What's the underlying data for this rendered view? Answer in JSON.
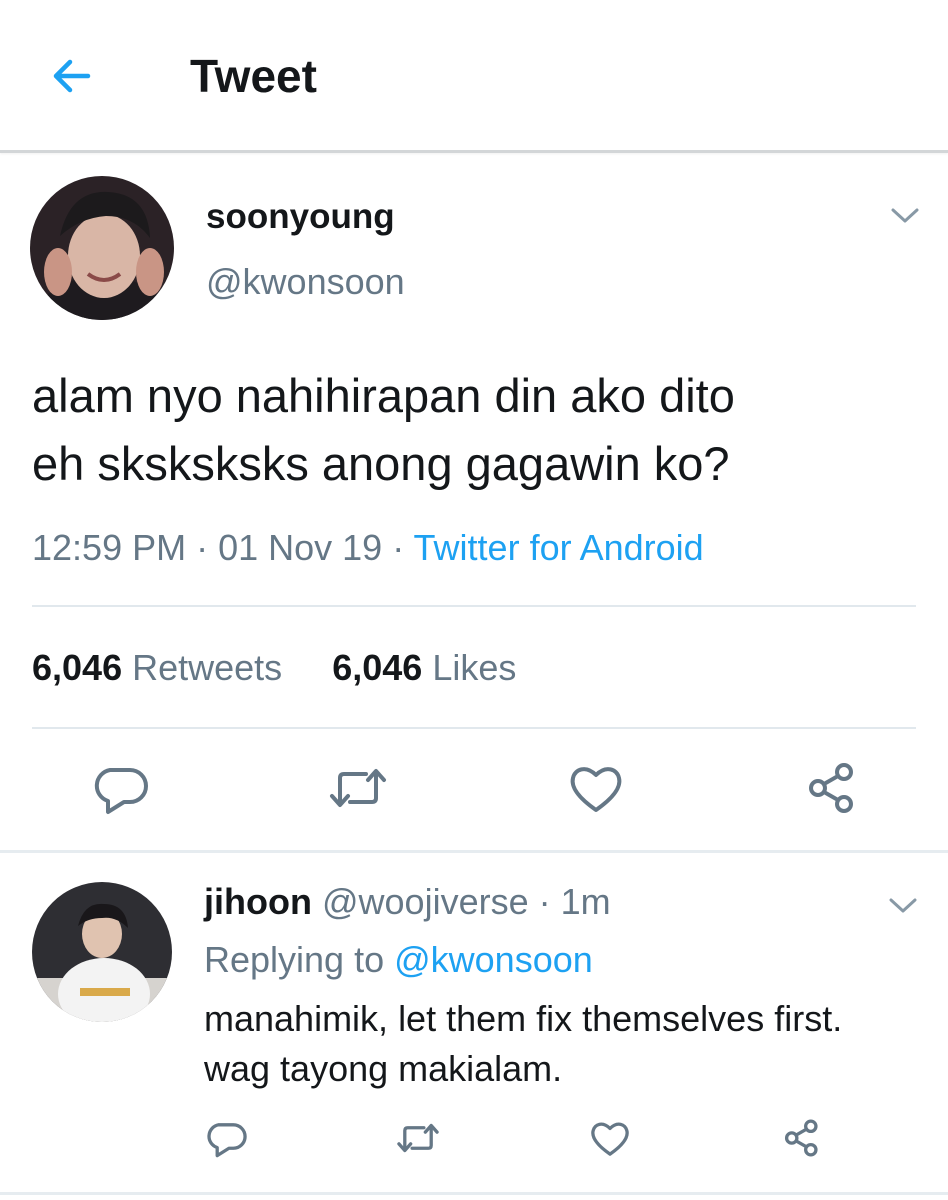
{
  "header": {
    "title": "Tweet",
    "back_icon": "back-arrow-icon"
  },
  "colors": {
    "accent": "#1da1f2",
    "secondary_text": "#657786",
    "primary_text": "#14171a",
    "divider": "#e1e8ed"
  },
  "tweet": {
    "author_name": "soonyoung",
    "author_handle": "@kwonsoon",
    "text_line1": "alam nyo nahihirapan din ako dito",
    "text_line2": "eh sksksksks anong gagawin ko?",
    "time": "12:59 PM",
    "sep1": " · ",
    "date": "01 Nov 19",
    "sep2": " · ",
    "source": "Twitter for Android",
    "retweet_count": "6,046",
    "retweet_label": "Retweets",
    "like_count": "6,046",
    "like_label": "Likes",
    "actions": [
      "reply-icon",
      "retweet-icon",
      "like-icon",
      "share-icon"
    ]
  },
  "reply": {
    "author_name": "jihoon",
    "author_handle": "@woojiverse",
    "sep": " · ",
    "time": "1m",
    "replying_prefix": "Replying to ",
    "replying_to": "@kwonsoon",
    "text_line1": "manahimik, let them fix themselves first.",
    "text_line2": "wag tayong makialam.",
    "actions": [
      "reply-icon",
      "retweet-icon",
      "like-icon",
      "share-icon"
    ]
  }
}
